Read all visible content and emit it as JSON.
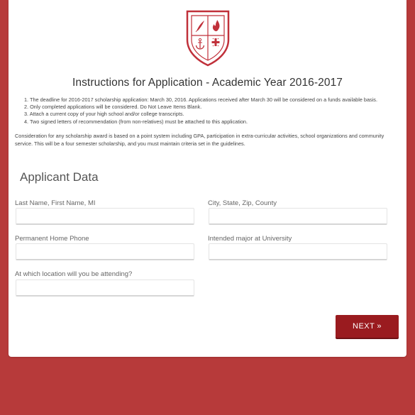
{
  "header": {
    "title": "Instructions for Application - Academic Year 2016-2017"
  },
  "instructions": [
    "1. The deadline for 2016-2017 scholarship application: March 30, 2016. Applications received after March 30 will be considered on a funds available basis.",
    "2. Only completed applications will be considered. Do Not Leave Items Blank.",
    "3. Attach a current copy of your high school and/or college transcripts.",
    "4. Two signed letters of recommendation (from non-relatives) must be attached to this application."
  ],
  "paragraph": "Consideration for any scholarship award is based on a point system including GPA, participation in extra-curricular activities, school organizations and community service. This will be a four semester scholarship, and you must maintain criteria set in the guidelines.",
  "form": {
    "section_title": "Applicant Data",
    "fields": {
      "name": {
        "label": "Last Name, First Name, MI",
        "value": "",
        "placeholder": ""
      },
      "city": {
        "label": "City, State, Zip, County",
        "value": "",
        "placeholder": ""
      },
      "phone": {
        "label": "Permanent Home Phone",
        "value": "",
        "placeholder": ""
      },
      "major": {
        "label": "Intended major at University",
        "value": "",
        "placeholder": ""
      },
      "location": {
        "label": "At which location will you be attending?",
        "value": "",
        "placeholder": ""
      }
    },
    "next_label": "NEXT",
    "next_glyph": "»"
  },
  "colors": {
    "background": "#b73a3a",
    "accent": "#9a1b1f",
    "crest": "#c0303a"
  },
  "icons": {
    "crest": "shield-crest-icon",
    "feather": "feather-icon",
    "flame": "flame-icon",
    "anchor": "anchor-icon",
    "cross": "cross-icon"
  }
}
